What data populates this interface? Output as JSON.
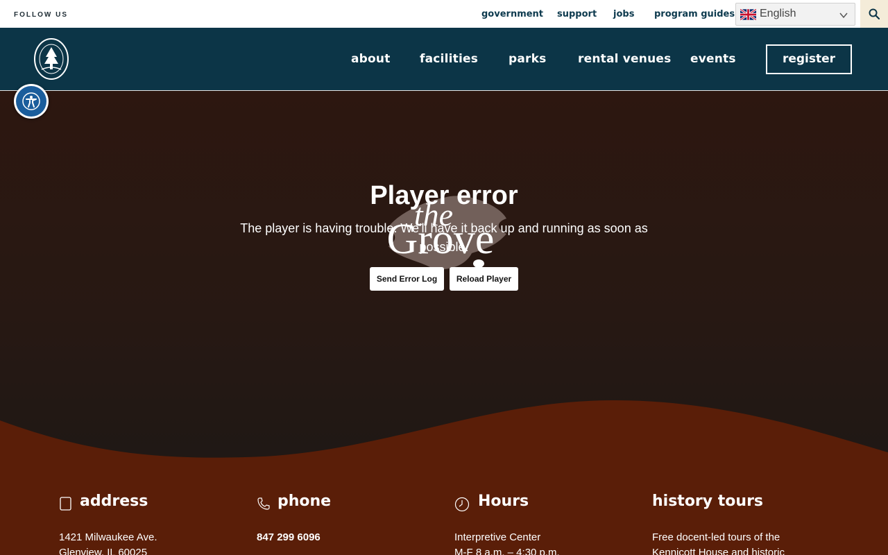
{
  "topbar": {
    "follow_label": "FOLLOW US",
    "links": [
      "government",
      "support",
      "jobs",
      "program guides"
    ],
    "language": "English"
  },
  "nav": {
    "items": [
      "about",
      "facilities",
      "parks",
      "rental venues",
      "events"
    ],
    "register_label": "register"
  },
  "player": {
    "title": "Player error",
    "message": "The player is having trouble. We'll have it back up and running as soon as possible.",
    "send_log_label": "Send Error Log",
    "reload_label": "Reload Player"
  },
  "grove_logo": {
    "line1": "the",
    "line2": "Grove"
  },
  "info": {
    "address": {
      "heading": "address",
      "line1": "1421 Milwaukee Ave.",
      "line2": "Glenview, IL 60025"
    },
    "phone": {
      "heading": "phone",
      "number": "847 299 6096"
    },
    "hours": {
      "heading": "Hours",
      "line1": "Interpretive Center",
      "line2": "M-F 8 a.m. – 4:30 p.m."
    },
    "tours": {
      "heading": "history tours",
      "line1": "Free docent-led tours of the",
      "line2": "Kennicott House and historic"
    }
  },
  "colors": {
    "navy": "#0c3547",
    "hero_brown": "#2d1710",
    "footer_rust": "#5a1e08",
    "cream": "#f4ecd9",
    "accessibility_blue": "#1a5d9c"
  },
  "icons": [
    "search-icon",
    "chevron-down-icon",
    "uk-flag-icon",
    "accessibility-icon",
    "park-district-logo",
    "map-pin-icon",
    "phone-icon",
    "clock-icon"
  ]
}
